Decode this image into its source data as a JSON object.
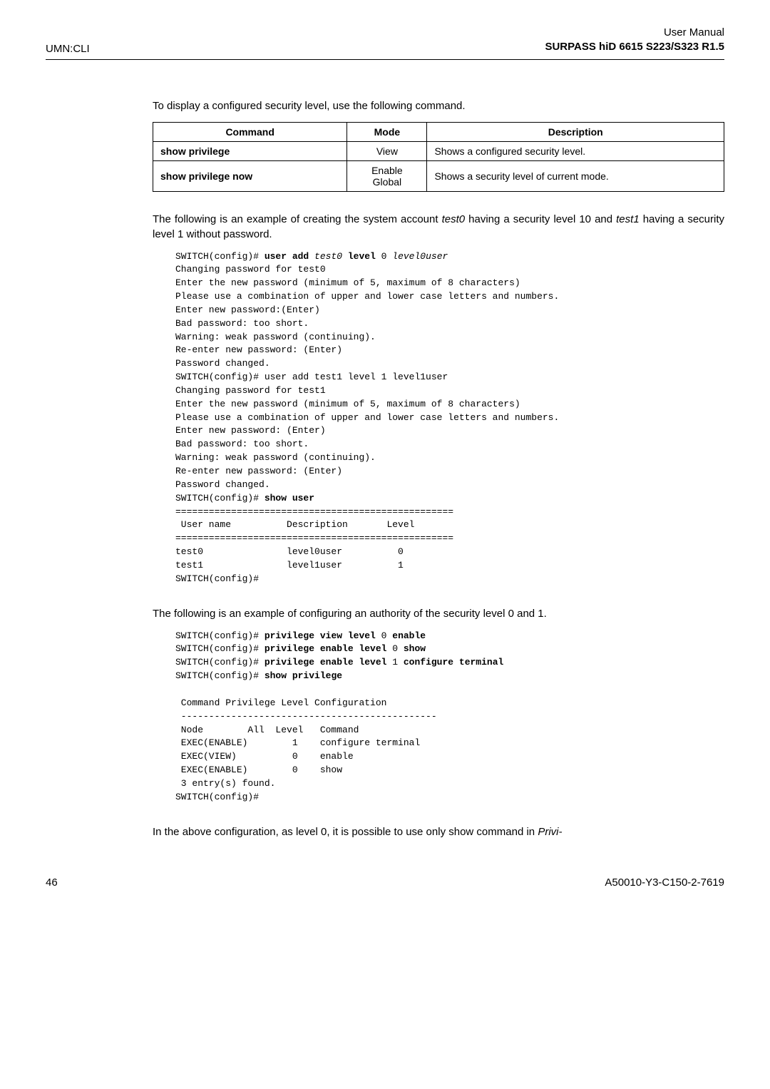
{
  "header": {
    "left": "UMN:CLI",
    "right_line1": "User Manual",
    "right_line2": "SURPASS hiD 6615 S223/S323 R1.5"
  },
  "intro_para": "To display a configured security level, use the following command.",
  "table": {
    "headers": {
      "c0": "Command",
      "c1": "Mode",
      "c2": "Description"
    },
    "rows": [
      {
        "cmd": "show privilege",
        "mode": "View",
        "desc": "Shows a configured security level."
      },
      {
        "cmd": "show privilege now",
        "mode": "Enable\nGlobal",
        "desc": "Shows a security level of current mode."
      }
    ]
  },
  "para2_pre": "The following is an example of creating the system account ",
  "para2_ital1": "test0",
  "para2_mid": " having a security level 10 and ",
  "para2_ital2": "test1",
  "para2_post": " having a security level 1 without password.",
  "code1": {
    "l1a": "SWITCH(config)# ",
    "l1b": "user add",
    "l1c": " test0 ",
    "l1d": "level",
    "l1e": " 0 ",
    "l1f": "level0user",
    "l2": "Changing password for test0",
    "l3": "Enter the new password (minimum of 5, maximum of 8 characters)",
    "l4": "Please use a combination of upper and lower case letters and numbers.",
    "l5": "Enter new password:(Enter)",
    "l6": "Bad password: too short.",
    "l7": "Warning: weak password (continuing).",
    "l8": "Re-enter new password: (Enter)",
    "l9": "Password changed.",
    "l10": "SWITCH(config)# user add test1 level 1 level1user",
    "l11": "Changing password for test1",
    "l12": "Enter the new password (minimum of 5, maximum of 8 characters)",
    "l13": "Please use a combination of upper and lower case letters and numbers.",
    "l14": "Enter new password: (Enter)",
    "l15": "Bad password: too short.",
    "l16": "Warning: weak password (continuing).",
    "l17": "Re-enter new password: (Enter)",
    "l18": "Password changed.",
    "l19a": "SWITCH(config)# ",
    "l19b": "show user",
    "l20": "==================================================",
    "l21": " User name          Description       Level",
    "l22": "==================================================",
    "l23": "test0               level0user          0",
    "l24": "test1               level1user          1",
    "l25": "SWITCH(config)#"
  },
  "para3": "The following is an example of configuring an authority of the security level 0 and 1.",
  "code2": {
    "l1a": "SWITCH(config)# ",
    "l1b": "privilege view level",
    "l1c": " 0 ",
    "l1d": "enable",
    "l2a": "SWITCH(config)# ",
    "l2b": "privilege enable level",
    "l2c": " 0 ",
    "l2d": "show",
    "l3a": "SWITCH(config)# ",
    "l3b": "privilege enable level",
    "l3c": " 1 ",
    "l3d": "configure terminal",
    "l4a": "SWITCH(config)# ",
    "l4b": "show privilege",
    "l5": "",
    "l6": " Command Privilege Level Configuration",
    "l7": " ----------------------------------------------",
    "l8": " Node        All  Level   Command",
    "l9": " EXEC(ENABLE)        1    configure terminal",
    "l10": " EXEC(VIEW)          0    enable",
    "l11": " EXEC(ENABLE)        0    show",
    "l12": " 3 entry(s) found.",
    "l13": "SWITCH(config)#"
  },
  "para4_pre": "In the above configuration, as level 0, it is possible to use only show command in ",
  "para4_ital": "Privi-",
  "footer": {
    "left": "46",
    "right": "A50010-Y3-C150-2-7619"
  }
}
